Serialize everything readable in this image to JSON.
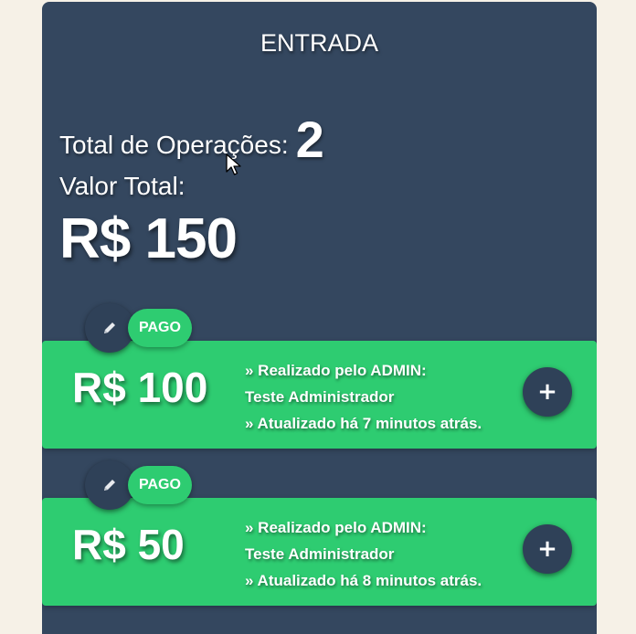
{
  "panel": {
    "title": "ENTRADA",
    "ops_label": "Total de Operações:",
    "ops_count": "2",
    "valor_label": "Valor Total:",
    "valor_value": "R$ 150"
  },
  "entries": [
    {
      "status": "PAGO",
      "amount": "R$ 100",
      "realizado": "» Realizado pelo ADMIN:",
      "user": "Teste Administrador",
      "updated": "» Atualizado há 7 minutos atrás.",
      "plus": "+"
    },
    {
      "status": "PAGO",
      "amount": "R$ 50",
      "realizado": "» Realizado pelo ADMIN:",
      "user": "Teste Administrador",
      "updated": "» Atualizado há 8 minutos atrás.",
      "plus": "+"
    }
  ],
  "icons": {
    "edit": "pencil-icon",
    "add": "plus-icon",
    "cursor": "mouse-cursor-icon"
  },
  "colors": {
    "background": "#f6f1e7",
    "panel": "#34475f",
    "card": "#2ecc71",
    "button": "#2f4158",
    "text": "#ffffff"
  }
}
